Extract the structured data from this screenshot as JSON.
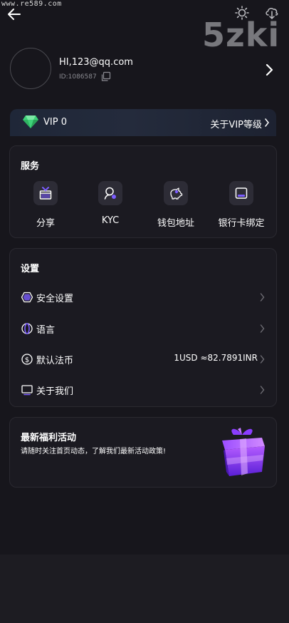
{
  "watermark": {
    "url": "www.re589.com",
    "logo": "5zki"
  },
  "profile": {
    "email": "HI,123@qq.com",
    "id": "ID:1086587"
  },
  "vip": {
    "level": "VIP 0",
    "link_label": "关于VIP等级"
  },
  "services": {
    "title": "服务",
    "items": [
      {
        "label": "分享",
        "icon": "gift-icon"
      },
      {
        "label": "KYC",
        "icon": "user-search-icon"
      },
      {
        "label": "钱包地址",
        "icon": "piggy-bank-icon"
      },
      {
        "label": "银行卡绑定",
        "icon": "card-icon"
      }
    ]
  },
  "settings": {
    "title": "设置",
    "items": [
      {
        "label": "安全设置",
        "value": "",
        "icon": "hexagon-icon"
      },
      {
        "label": "语言",
        "value": "",
        "icon": "globe-icon"
      },
      {
        "label": "默认法币",
        "value": "1USD ≈82.7891INR",
        "icon": "dollar-icon"
      },
      {
        "label": "关于我们",
        "value": "",
        "icon": "monitor-icon"
      }
    ]
  },
  "promo": {
    "title": "最新福利活动",
    "description": "请随时关注首页动态，了解我们最新活动政策!"
  },
  "colors": {
    "background": "#17161c",
    "card": "#1b1a21",
    "accent": "#7b5cff",
    "diamond": "#3fd37a"
  }
}
